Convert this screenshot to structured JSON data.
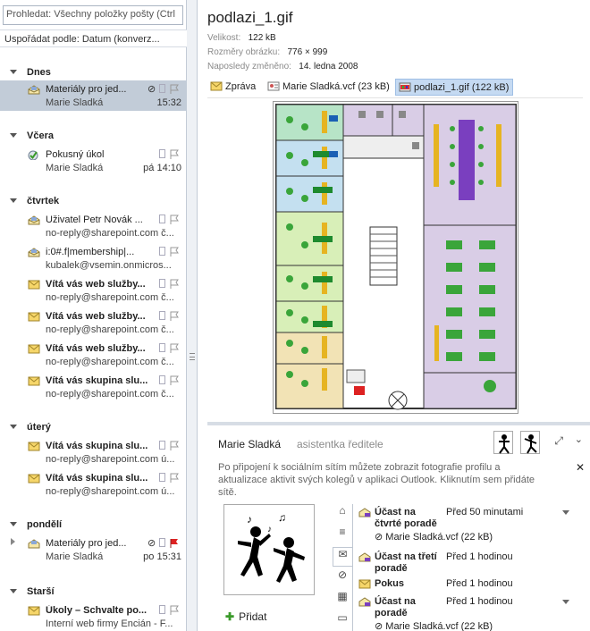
{
  "search": {
    "placeholder": "Prohledat: Všechny položky pošty (Ctrl"
  },
  "sort": {
    "label": "Uspořádat podle: Datum (konverz..."
  },
  "groups": {
    "dnes": "Dnes",
    "vcera": "Včera",
    "ctvrtek": "čtvrtek",
    "utery": "úterý",
    "pondeli": "pondělí",
    "starsi": "Starší"
  },
  "mails": [
    {
      "from": "Materiály pro jed...",
      "sub": "Marie Sladká",
      "time": "15:32",
      "bold": false
    },
    {
      "from": "Pokusný úkol",
      "sub": "Marie Sladká",
      "time": "pá 14:10",
      "bold": false
    },
    {
      "from": "Uživatel Petr Novák ...",
      "sub": "no-reply@sharepoint.com č...",
      "time": "",
      "bold": false
    },
    {
      "from": "i:0#.f|membership|...",
      "sub": "kubalek@vsemin.onmicros...",
      "time": "",
      "bold": false
    },
    {
      "from": "Vítá vás web služby...",
      "sub": "no-reply@sharepoint.com č...",
      "time": "",
      "bold": true
    },
    {
      "from": "Vítá vás web služby...",
      "sub": "no-reply@sharepoint.com č...",
      "time": "",
      "bold": true
    },
    {
      "from": "Vítá vás web služby...",
      "sub": "no-reply@sharepoint.com č...",
      "time": "",
      "bold": true
    },
    {
      "from": "Vítá vás skupina slu...",
      "sub": "no-reply@sharepoint.com č...",
      "time": "",
      "bold": true
    },
    {
      "from": "Vítá vás skupina slu...",
      "sub": "no-reply@sharepoint.com ú...",
      "time": "",
      "bold": true
    },
    {
      "from": "Vítá vás skupina slu...",
      "sub": "no-reply@sharepoint.com ú...",
      "time": "",
      "bold": true
    },
    {
      "from": "Materiály pro jed...",
      "sub": "Marie Sladká",
      "time": "po 15:31",
      "bold": false
    },
    {
      "from": "Úkoly – Schvalte po...",
      "sub": "Interní web firmy Encián - F...",
      "time": "",
      "bold": true
    }
  ],
  "reading": {
    "title": "podlazi_1.gif",
    "size_label": "Velikost:",
    "size_value": "122 kB",
    "dims_label": "Rozměry obrázku:",
    "dims_value": "776 × 999",
    "modified_label": "Naposledy změněno:",
    "modified_value": "14. ledna 2008"
  },
  "attachments": {
    "message": "Zpráva",
    "vcf": "Marie Sladká.vcf (23 kB)",
    "gif": "podlazi_1.gif (122 kB)"
  },
  "social": {
    "name": "Marie Sladká",
    "role": "asistentka ředitele",
    "info": "Po připojení k sociálním sítím můžete zobrazit fotografie profilu a aktualizace aktivit svých kolegů v aplikaci Outlook. Kliknutím sem přidáte sítě.",
    "add": "Přidat"
  },
  "feed": [
    {
      "title": "Účast na čtvrté poradě",
      "time": "Před 50 minutami",
      "file": "Marie Sladká.vcf (22 kB)"
    },
    {
      "title": "Účast na třetí poradě",
      "time": "Před 1 hodinou",
      "file": ""
    },
    {
      "title": "Pokus",
      "time": "Před 1 hodinou",
      "file": ""
    },
    {
      "title": "Účast na poradě",
      "time": "Před 1 hodinou",
      "file": "Marie Sladká.vcf (22 kB)"
    }
  ],
  "colors": {
    "selected_row": "#c2ccd8",
    "accent": "#c5daf2"
  }
}
